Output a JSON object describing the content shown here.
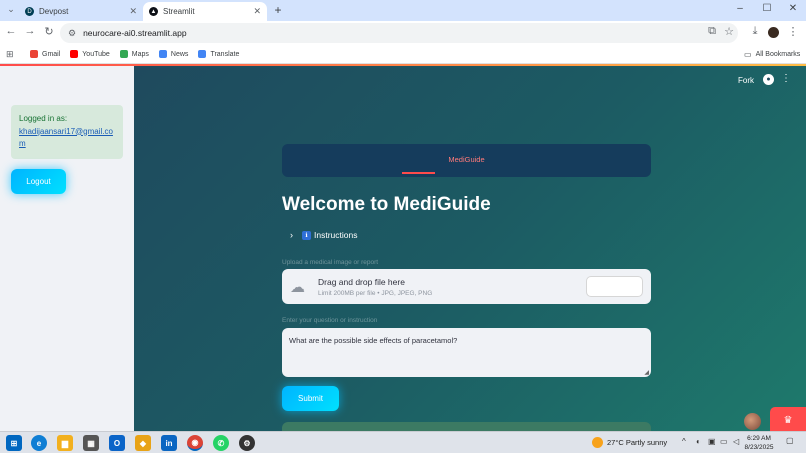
{
  "browser": {
    "tabs": [
      {
        "title": "Devpost",
        "active": false,
        "favicon_color": "#003e54"
      },
      {
        "title": "Streamlit",
        "active": true,
        "favicon_color": "#0e1117"
      }
    ],
    "new_tab_glyph": "+",
    "window_controls": {
      "minimize": "–",
      "maximize": "☐",
      "close": "✕"
    },
    "url": "neurocare-ai0.streamlit.app",
    "bookmarks": [
      {
        "label": "Gmail",
        "color": "#ea4335"
      },
      {
        "label": "YouTube",
        "color": "#ff0000"
      },
      {
        "label": "Maps",
        "color": "#34a853"
      },
      {
        "label": "News",
        "color": "#4285f4"
      },
      {
        "label": "Translate",
        "color": "#4285f4"
      }
    ],
    "all_bookmarks": "All Bookmarks"
  },
  "sidebar": {
    "logged_in_label": "Logged in as:",
    "email": "khadijaansari17@gmail.com",
    "logout_label": "Logout"
  },
  "header": {
    "fork_label": "Fork"
  },
  "main": {
    "nav_tab": "MediGuide",
    "title": "Welcome to MediGuide",
    "instructions_label": "Instructions",
    "instructions_badge": "ℹ",
    "upload_label": "Upload a medical image or report",
    "dropzone_title": "Drag and drop file here",
    "dropzone_limits": "Limit 200MB per file • JPG, JPEG, PNG",
    "question_label": "Enter your question or instruction",
    "question_value": "What are the possible side effects of paracetamol?",
    "submit_label": "Submit"
  },
  "taskbar": {
    "apps": [
      {
        "name": "start",
        "color": "#0067c0",
        "glyph": "⊞"
      },
      {
        "name": "edge",
        "color": "#0f7ed4",
        "glyph": "e"
      },
      {
        "name": "explorer",
        "color": "#f2b01e",
        "glyph": "▆"
      },
      {
        "name": "store",
        "color": "#444",
        "glyph": "▦"
      },
      {
        "name": "outlook",
        "color": "#0a64c8",
        "glyph": "O"
      },
      {
        "name": "git",
        "color": "#e8a317",
        "glyph": "◆"
      },
      {
        "name": "linkedin",
        "color": "#0a66c2",
        "glyph": "in"
      },
      {
        "name": "chrome",
        "color": "#db4437",
        "glyph": "◉"
      },
      {
        "name": "whatsapp",
        "color": "#25d366",
        "glyph": "✆"
      },
      {
        "name": "chatgpt",
        "color": "#333",
        "glyph": "⚙"
      }
    ],
    "weather_temp": "27°C",
    "weather_text": "Partly sunny",
    "time": "6:29 AM",
    "date": "8/23/2025"
  }
}
